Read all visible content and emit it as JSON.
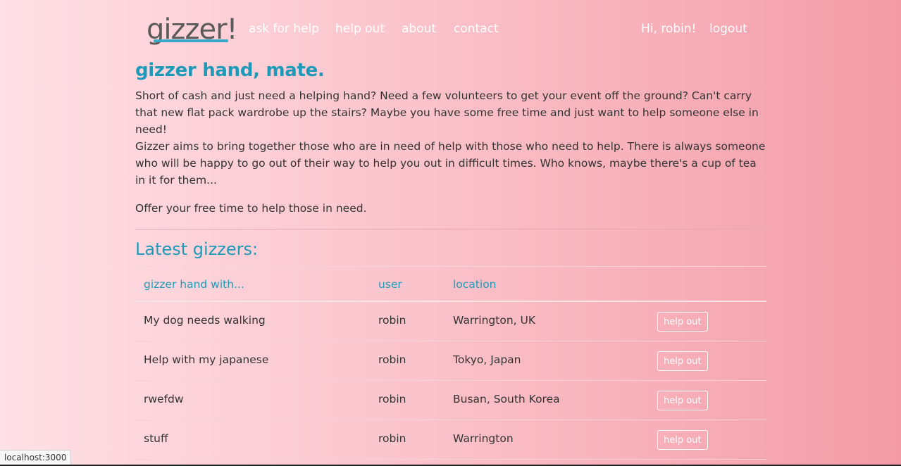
{
  "nav": {
    "logo": "gizzer!",
    "links": [
      "ask for help",
      "help out",
      "about",
      "contact"
    ],
    "greeting": "Hi, robin!",
    "logout": "logout"
  },
  "main": {
    "heading": "gizzer hand, mate.",
    "paragraph1": "Short of cash and just need a helping hand? Need a few volunteers to get your event off the ground? Can't carry that new flat pack wardrobe up the stairs? Maybe you have some free time and just want to help someone else in need!",
    "paragraph2": "Gizzer aims to bring together those who are in need of help with those who need to help. There is always someone who will be happy to go out of their way to help you out in difficult times. Who knows, maybe there's a cup of tea in it for them...",
    "paragraph3": "Offer your free time to help those in need."
  },
  "latest": {
    "title": "Latest gizzers:",
    "columns": [
      "gizzer hand with...",
      "user",
      "location"
    ],
    "rows": [
      {
        "task": "My dog needs walking",
        "user": "robin",
        "location": "Warrington, UK",
        "action": "help out"
      },
      {
        "task": "Help with my japanese",
        "user": "robin",
        "location": "Tokyo, Japan",
        "action": "help out"
      },
      {
        "task": "rwefdw",
        "user": "robin",
        "location": "Busan, South Korea",
        "action": "help out"
      },
      {
        "task": "stuff",
        "user": "robin",
        "location": "Warrington",
        "action": "help out"
      }
    ]
  },
  "status_bar": {
    "url": "localhost:3000"
  },
  "colors": {
    "accent": "#1d9ab8",
    "logo": "#5b5b5b",
    "underline": "#36a9c6"
  }
}
